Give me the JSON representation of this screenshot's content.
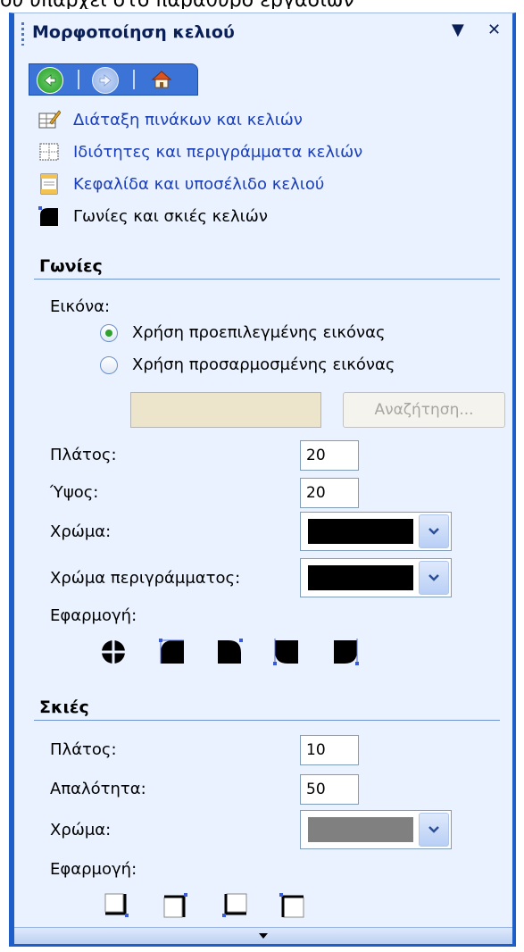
{
  "caption": "ου υπάρχει στο παράθυρο εργασιών",
  "pane": {
    "title": "Μορφοποίηση κελιού",
    "menu_glyph": "▼",
    "close_glyph": "✕"
  },
  "links": [
    {
      "label": "Διάταξη πινάκων και κελιών",
      "icon": "table-layout-icon"
    },
    {
      "label": "Ιδιότητες και περιγράμματα κελιών",
      "icon": "cell-borders-icon"
    },
    {
      "label": "Κεφαλίδα και υποσέλιδο κελιού",
      "icon": "header-footer-icon"
    },
    {
      "label": "Γωνίες και σκιές κελιών",
      "icon": "corners-shadows-icon"
    }
  ],
  "corners": {
    "heading": "Γωνίες",
    "image_label": "Εικόνα:",
    "radio_default": "Χρήση προεπιλεγμένης εικόνας",
    "radio_custom": "Χρήση προσαρμοσμένης εικόνας",
    "browse_label": "Αναζήτηση...",
    "width_label": "Πλάτος:",
    "width_value": "20",
    "height_label": "Ύψος:",
    "height_value": "20",
    "color_label": "Χρώμα:",
    "color_value": "#000000",
    "border_color_label": "Χρώμα περιγράμματος:",
    "border_color_value": "#000000",
    "apply_label": "Εφαρμογή:"
  },
  "shadows": {
    "heading": "Σκιές",
    "width_label": "Πλάτος:",
    "width_value": "10",
    "softness_label": "Απαλότητα:",
    "softness_value": "50",
    "color_label": "Χρώμα:",
    "color_value": "#808080",
    "apply_label": "Εφαρμογή:"
  },
  "colors": {
    "accent": "#1d5ec9",
    "panel_bg": "#eaf2ff",
    "link": "#1a3fb8"
  }
}
